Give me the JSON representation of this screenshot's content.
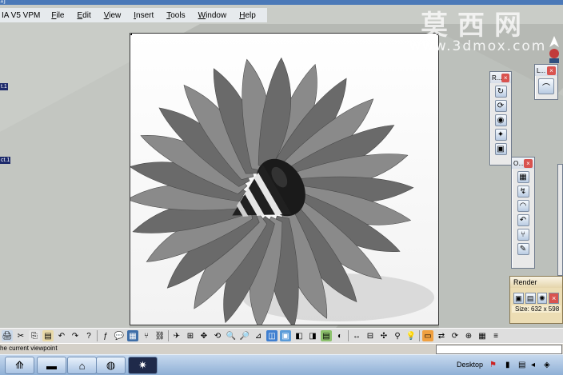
{
  "window": {
    "title_fragment": "1]",
    "app_name": "IA V5 VPM"
  },
  "menu": [
    {
      "key": "F",
      "rest": "ile"
    },
    {
      "key": "E",
      "rest": "dit"
    },
    {
      "key": "V",
      "rest": "iew"
    },
    {
      "key": "I",
      "rest": "nsert"
    },
    {
      "key": "T",
      "rest": "ools"
    },
    {
      "key": "W",
      "rest": "indow"
    },
    {
      "key": "H",
      "rest": "elp"
    }
  ],
  "tree": {
    "label1": "t.1",
    "label2": "ct.1"
  },
  "watermark": {
    "chinese": "莫西网",
    "url": "www.3dmox.com"
  },
  "toolbars": {
    "r_title": "R...",
    "l_title": "L...",
    "o_title": "O...",
    "close_glyph": "×"
  },
  "render_panel": {
    "title": "Render",
    "size_text": "Size: 632 x 598"
  },
  "status": {
    "message": "he current viewpoint"
  },
  "taskbar": {
    "desktop_label": "Desktop"
  },
  "colors": {
    "accent": "#4b79b8",
    "spec_tree_label": "#1d2a6b",
    "render_panel": "#ecddb4"
  },
  "icons": {
    "toolbar_count_hint": "many"
  }
}
